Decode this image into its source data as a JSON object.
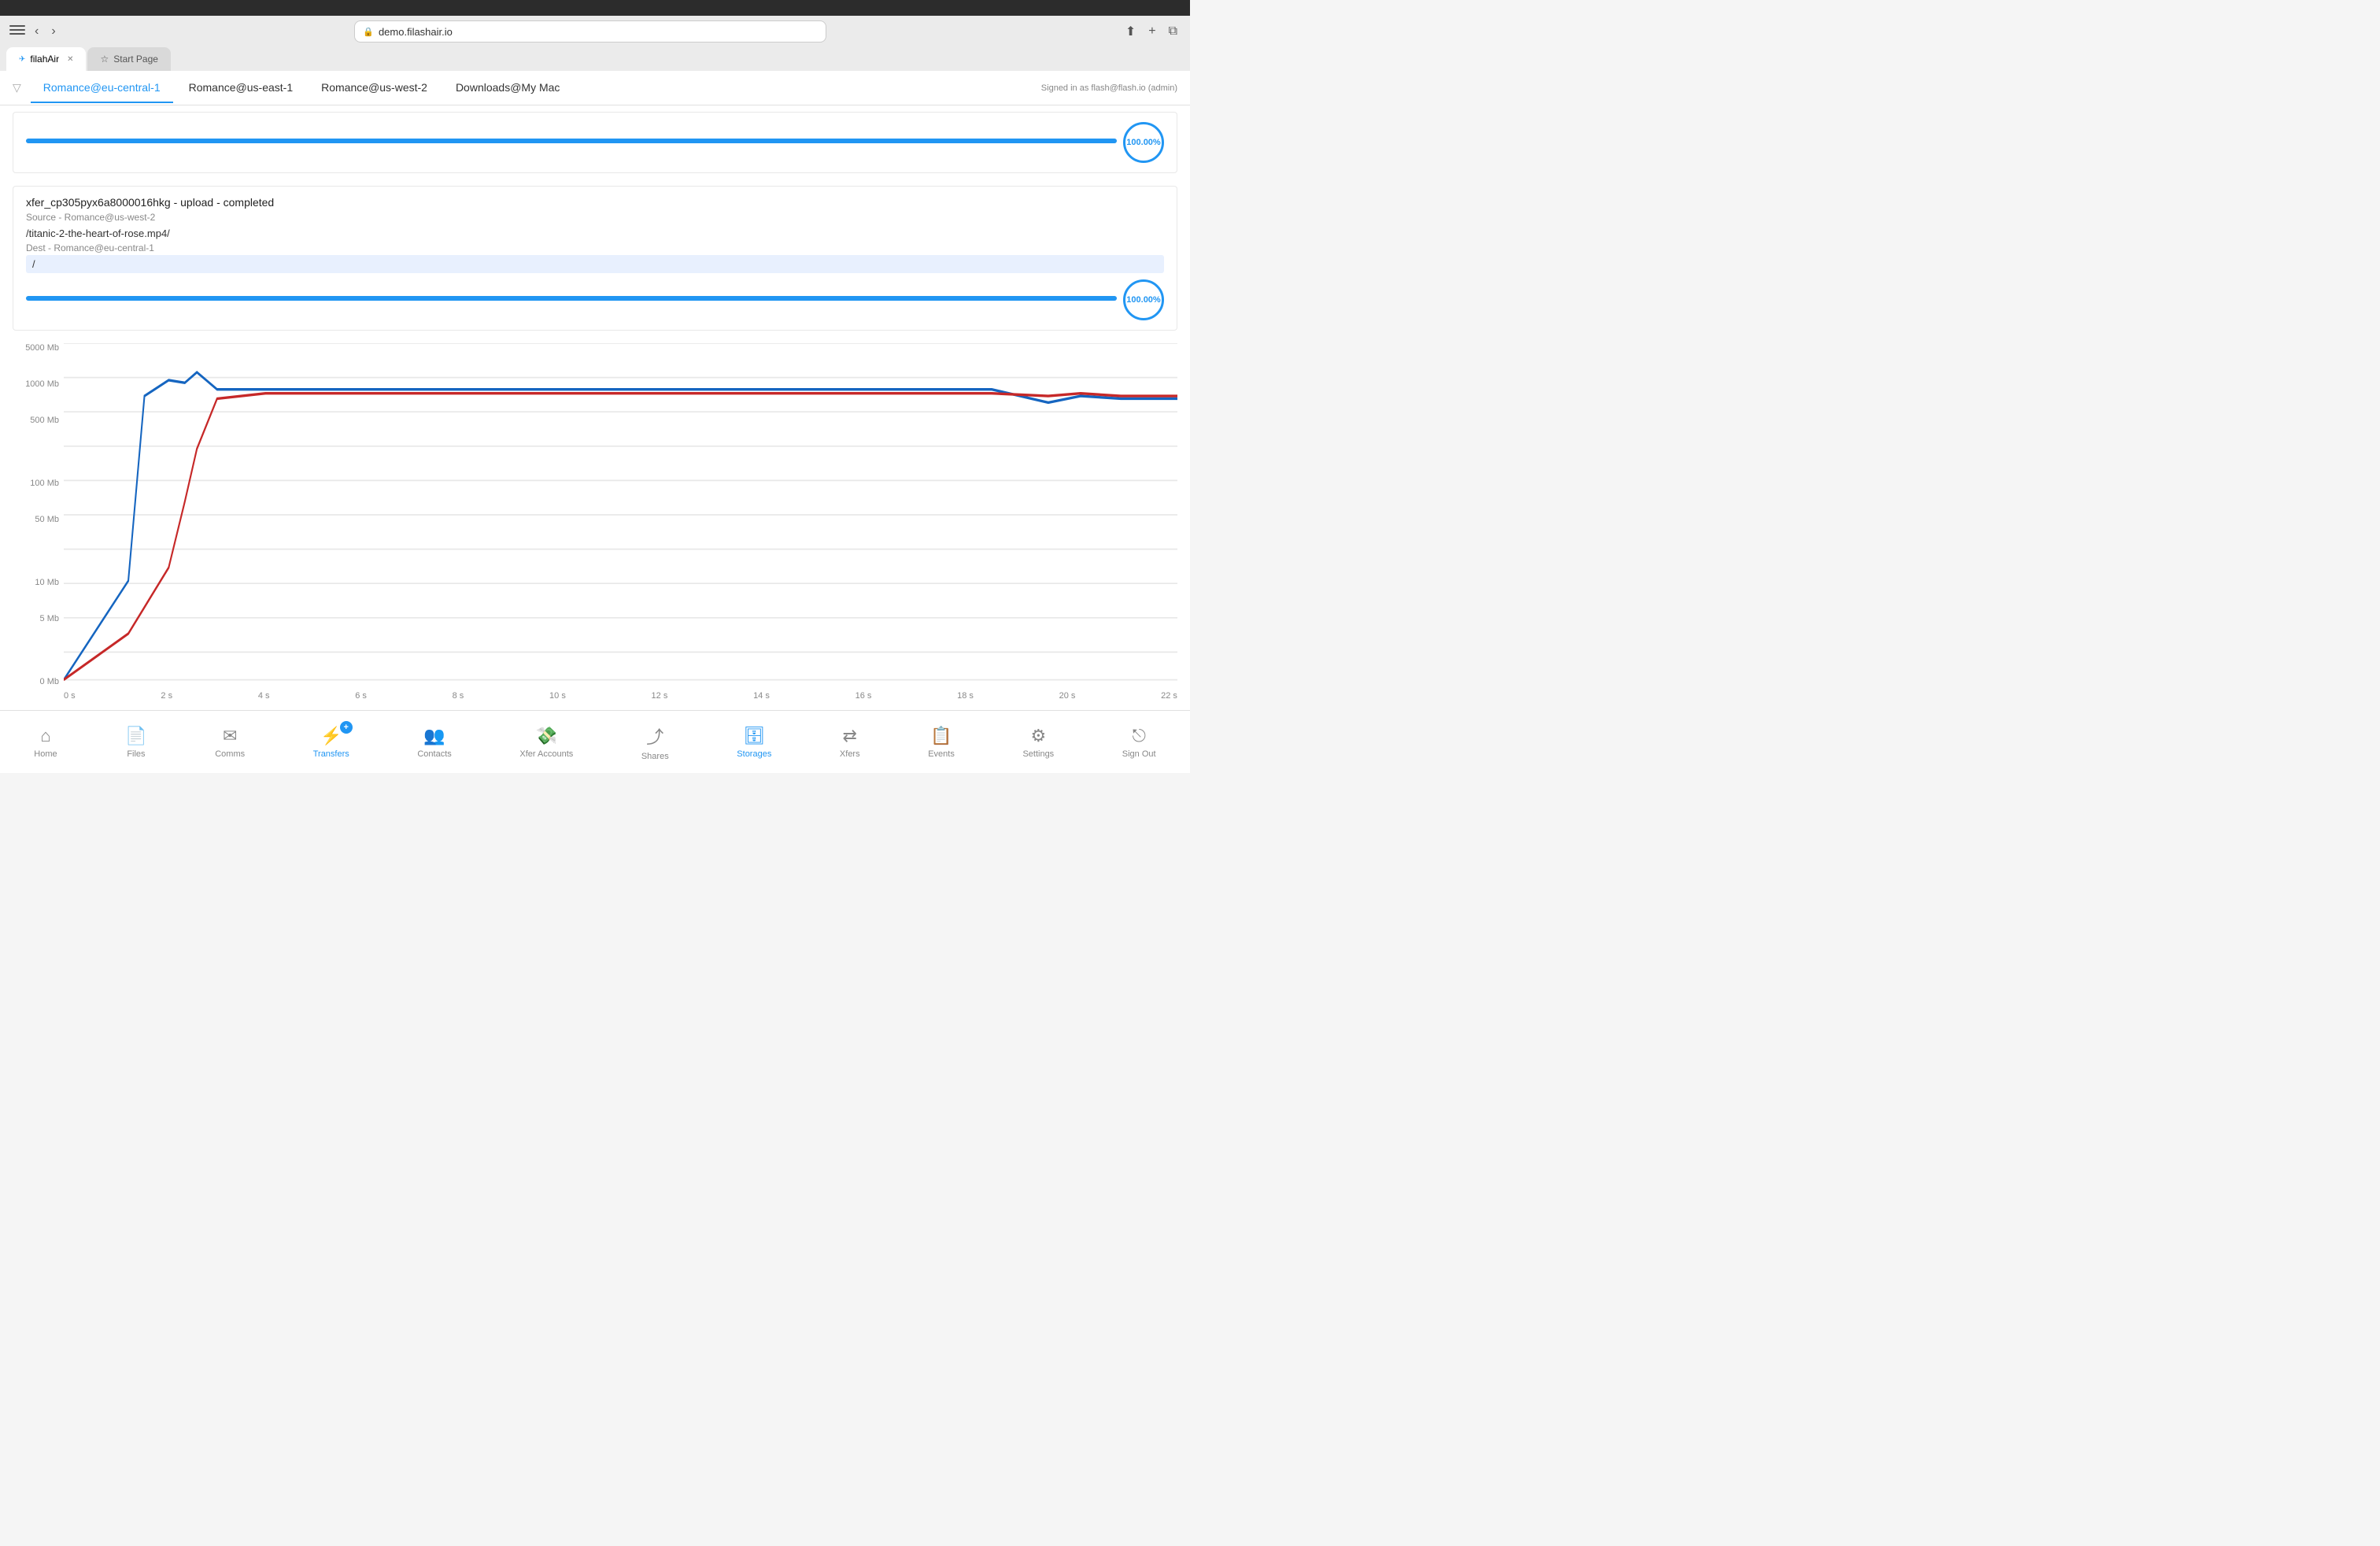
{
  "browser": {
    "url": "demo.filashair.io",
    "tab1_label": "filahAir",
    "tab2_label": "Start Page"
  },
  "app": {
    "signed_in": "Signed in as flash@flash.io (admin)",
    "nav_tabs": [
      {
        "label": "Romance@eu-central-1",
        "active": true
      },
      {
        "label": "Romance@us-east-1",
        "active": false
      },
      {
        "label": "Romance@us-west-2",
        "active": false
      },
      {
        "label": "Downloads@My Mac",
        "active": false
      }
    ],
    "transfers": [
      {
        "title": "xfer_cp305pyx6a8000016hkg - upload - completed",
        "source_label": "Source - Romance@us-west-2",
        "path": "/titanic-2-the-heart-of-rose.mp4/",
        "dest_label": "Dest - Romance@eu-central-1",
        "dest_path": "/",
        "progress": 100,
        "progress_text": "100.00%"
      }
    ],
    "chart": {
      "y_labels": [
        "5000 Mb",
        "1000 Mb",
        "500 Mb",
        "",
        "100 Mb",
        "50 Mb",
        "",
        "10 Mb",
        "5 Mb",
        "",
        "0 Mb"
      ],
      "x_labels": [
        "0 s",
        "2 s",
        "4 s",
        "6 s",
        "8 s",
        "10 s",
        "12 s",
        "14 s",
        "16 s",
        "18 s",
        "20 s",
        "22 s"
      ]
    },
    "bottom_nav": [
      {
        "label": "Home",
        "icon": "🏠",
        "active": false
      },
      {
        "label": "Files",
        "icon": "📄",
        "active": false
      },
      {
        "label": "Comms",
        "icon": "✈",
        "active": false
      },
      {
        "label": "Transfers",
        "icon": "⚡",
        "active": true,
        "badge": "+"
      },
      {
        "label": "Contacts",
        "icon": "👥",
        "active": false
      },
      {
        "label": "Xfer Accounts",
        "icon": "💸",
        "active": false
      },
      {
        "label": "Shares",
        "icon": "↗",
        "active": false
      },
      {
        "label": "Storages",
        "icon": "🗄",
        "active": false,
        "highlight": true
      },
      {
        "label": "Xfers",
        "icon": "⇄",
        "active": false
      },
      {
        "label": "Events",
        "icon": "📋",
        "active": false
      },
      {
        "label": "Settings",
        "icon": "⚙",
        "active": false
      },
      {
        "label": "Sign Out",
        "icon": "→",
        "active": false
      }
    ]
  }
}
